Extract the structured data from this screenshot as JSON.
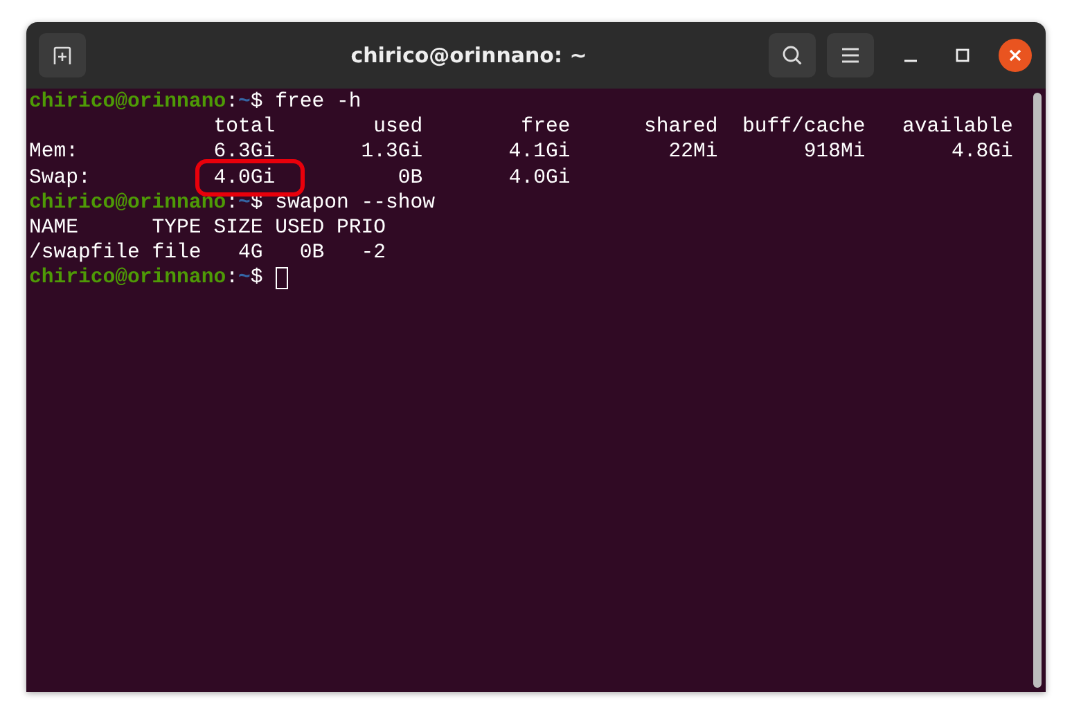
{
  "window": {
    "title": "chirico@orinnano: ~"
  },
  "terminal": {
    "lines": [
      {
        "kind": "prompt",
        "user_host": "chirico@orinnano",
        "colon": ":",
        "path": "~",
        "sigil": "$",
        "command": "free -h"
      },
      {
        "kind": "output",
        "segments": [
          {
            "text": "               total        used        free      shared  buff/cache   available",
            "highlighted": false
          }
        ]
      },
      {
        "kind": "output",
        "segments": [
          {
            "text": "Mem:           6.3Gi       1.3Gi       4.1Gi        22Mi       918Mi       4.8Gi",
            "highlighted": false
          }
        ]
      },
      {
        "kind": "output",
        "segments": [
          {
            "text": "Swap:",
            "highlighted": false
          },
          {
            "text": "4.0Gi",
            "highlighted": true
          },
          {
            "text": "0B       4.0Gi",
            "highlighted": false
          }
        ]
      },
      {
        "kind": "prompt",
        "user_host": "chirico@orinnano",
        "colon": ":",
        "path": "~",
        "sigil": "$",
        "command": "swapon --show"
      },
      {
        "kind": "output",
        "segments": [
          {
            "text": "NAME      TYPE SIZE USED PRIO",
            "highlighted": false
          }
        ]
      },
      {
        "kind": "output",
        "segments": [
          {
            "text": "/swapfile file   4G   0B   -2",
            "highlighted": false
          }
        ]
      },
      {
        "kind": "prompt",
        "user_host": "chirico@orinnano",
        "colon": ":",
        "path": "~",
        "sigil": "$",
        "cursor": true
      }
    ]
  }
}
